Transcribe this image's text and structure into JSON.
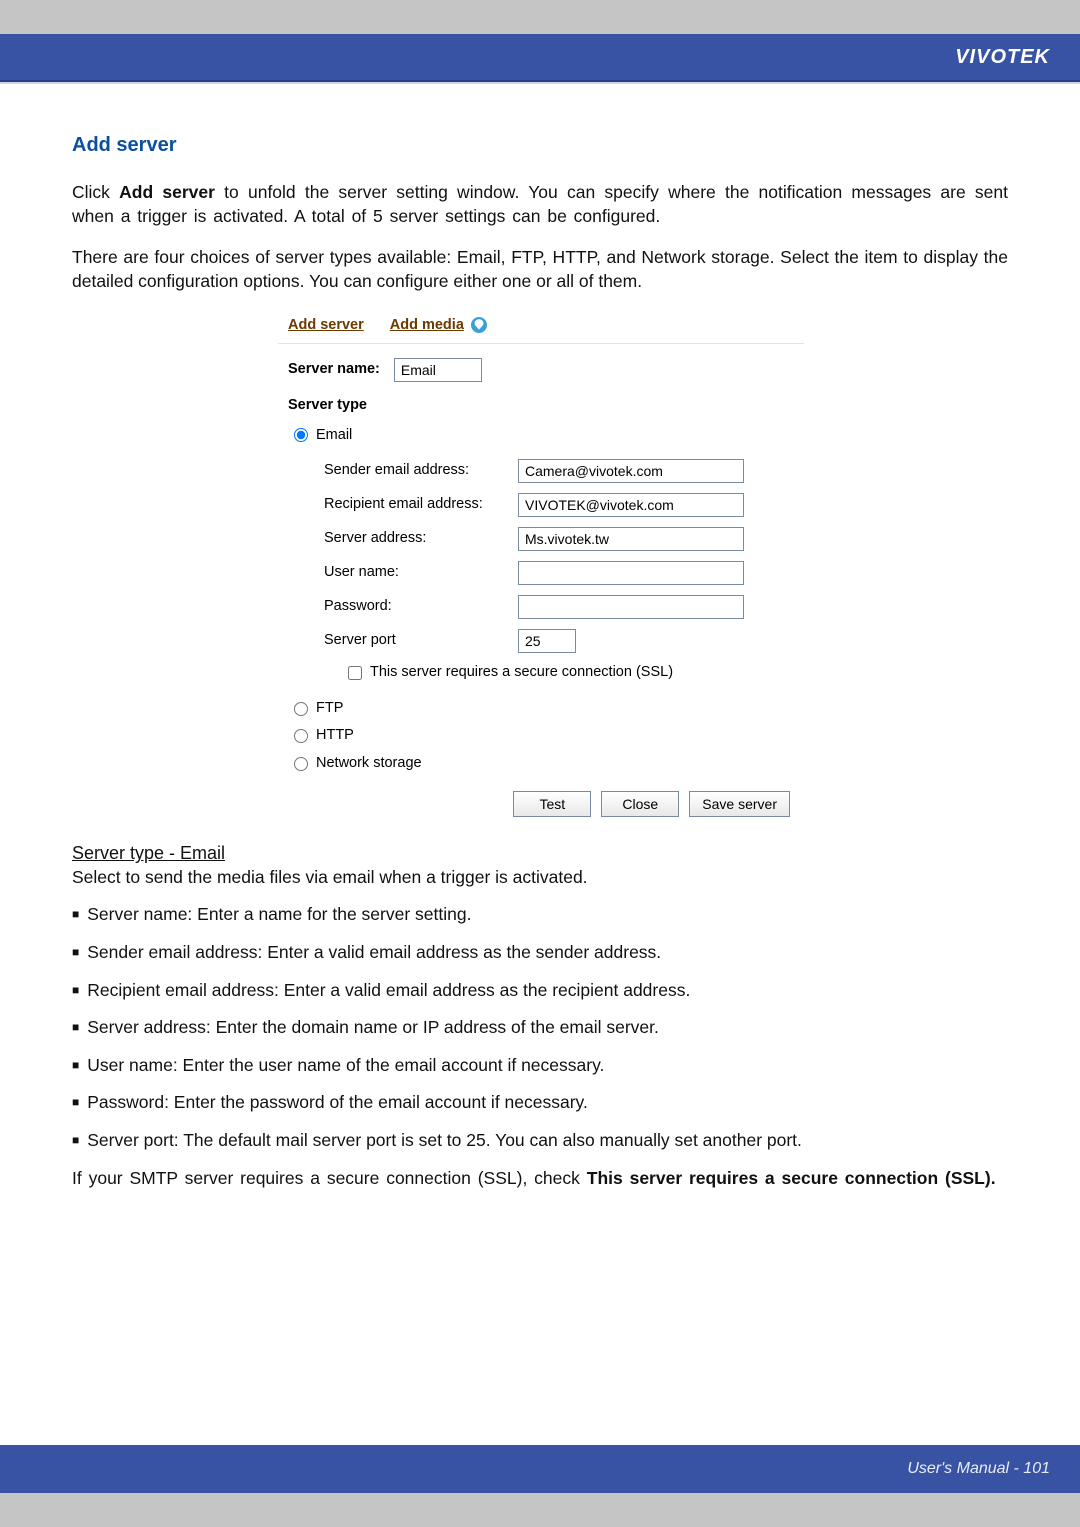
{
  "brand": "VIVOTEK",
  "footer": "User's Manual - 101",
  "heading": "Add server",
  "intro1_prefix": "Click ",
  "intro1_bold": "Add server",
  "intro1_suffix": " to unfold the server setting window. You can specify where the notification messages are sent when a trigger is activated. A total of 5 server settings can be configured.",
  "intro2": "There are four choices of server types available: Email, FTP, HTTP, and Network storage. Select the item to display the detailed configuration options. You can configure either one or all of them.",
  "tabs": {
    "add_server": "Add server",
    "add_media": "Add media"
  },
  "form": {
    "server_name_label": "Server name:",
    "server_name_value": "Email",
    "server_type_label": "Server type",
    "radio_email": "Email",
    "radio_ftp": "FTP",
    "radio_http": "HTTP",
    "radio_network_storage": "Network storage",
    "sender_label": "Sender email address:",
    "sender_value": "Camera@vivotek.com",
    "recipient_label": "Recipient email address:",
    "recipient_value": "VIVOTEK@vivotek.com",
    "server_addr_label": "Server address:",
    "server_addr_value": "Ms.vivotek.tw",
    "user_label": "User name:",
    "user_value": "",
    "pass_label": "Password:",
    "pass_value": "",
    "port_label": "Server port",
    "port_value": "25",
    "ssl_label": "This server requires a secure connection (SSL)",
    "btn_test": "Test",
    "btn_close": "Close",
    "btn_save": "Save server"
  },
  "section_email_heading": "Server type - Email",
  "section_email_intro": "Select to send the media files via email when a trigger is activated.",
  "bullets": {
    "b1": "Server name: Enter a name for the server setting.",
    "b2": "Sender email address: Enter a valid email address as the sender address.",
    "b3": "Recipient email address: Enter a valid email address as the recipient address.",
    "b4": "Server address: Enter the domain name or IP address of the email server.",
    "b5": "User name: Enter the user name of the email account if necessary.",
    "b6": "Password: Enter the password of the email account if necessary.",
    "b7": "Server port: The default mail server port is set to 25. You can also manually set another port."
  },
  "ssl_para_prefix": "If your SMTP server requires a secure connection (SSL), check ",
  "ssl_para_bold": "This server requires a secure connection (SSL)."
}
